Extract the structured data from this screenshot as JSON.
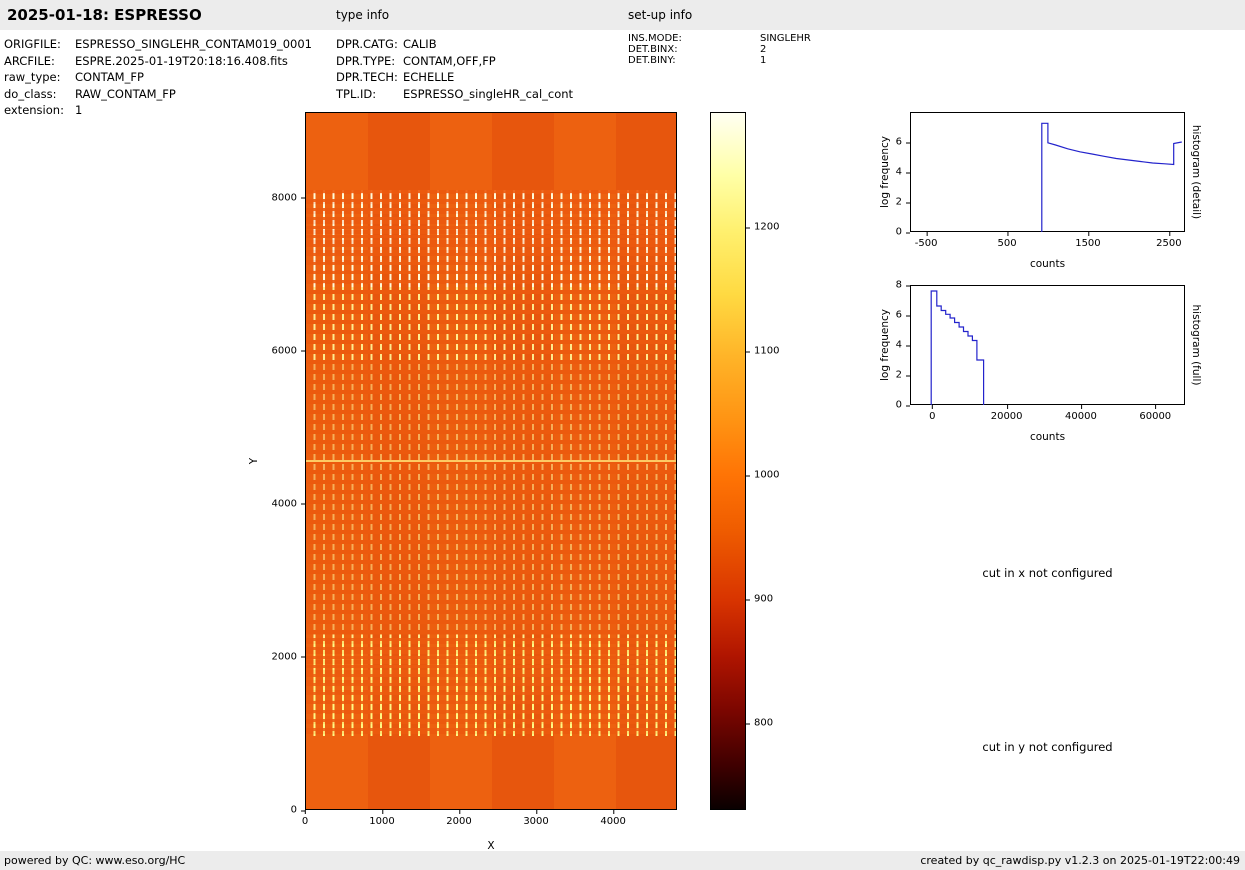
{
  "header": {
    "title": "2025-01-18: ESPRESSO",
    "type_info_label": "type info",
    "setup_info_label": "set-up info"
  },
  "metadata": {
    "file": [
      {
        "label": "ORIGFILE:",
        "value": "ESPRESSO_SINGLEHR_CONTAM019_0001"
      },
      {
        "label": "ARCFILE:",
        "value": "ESPRE.2025-01-19T20:18:16.408.fits"
      },
      {
        "label": "raw_type:",
        "value": "CONTAM_FP"
      },
      {
        "label": "do_class:",
        "value": "RAW_CONTAM_FP"
      },
      {
        "label": "extension:",
        "value": "1"
      }
    ],
    "type_info": [
      {
        "label": "DPR.CATG:",
        "value": "CALIB"
      },
      {
        "label": "DPR.TYPE:",
        "value": "CONTAM,OFF,FP"
      },
      {
        "label": "DPR.TECH:",
        "value": "ECHELLE"
      },
      {
        "label": "TPL.ID:",
        "value": "ESPRESSO_singleHR_cal_cont"
      }
    ],
    "setup_info": [
      {
        "label": "INS.MODE:",
        "value": "SINGLEHR"
      },
      {
        "label": "DET.BINX:",
        "value": "2"
      },
      {
        "label": "DET.BINY:",
        "value": "1"
      }
    ]
  },
  "chart_data": [
    {
      "id": "raw",
      "type": "heatmap",
      "xlabel": "X",
      "ylabel": "Y",
      "xlim": [
        0,
        4830
      ],
      "ylim": [
        0,
        9120
      ],
      "x_ticks": [
        0,
        1000,
        2000,
        3000,
        4000
      ],
      "y_ticks": [
        0,
        2000,
        4000,
        6000,
        8000
      ],
      "colormap": "hot",
      "description": "Raw ESPRESSO CONTAM_FP echelle frame: orange background near 1000 counts with dense columns of bright dashed Fabry-Perot emission lines between y~1000 and y~8200, brightest near the top and bottom of the order region, plus a thin bright horizontal feature near y~4600"
    },
    {
      "id": "colorbar",
      "type": "colorbar",
      "ylim": [
        730,
        1293
      ],
      "y_ticks": [
        1200,
        1100,
        1000,
        900,
        800
      ]
    },
    {
      "id": "hist-detail",
      "type": "line",
      "title": "histogram (detail)",
      "xlabel": "counts",
      "ylabel": "log frequency",
      "xlim": [
        -700,
        2700
      ],
      "ylim": [
        0,
        8
      ],
      "x_ticks": [
        -500,
        500,
        1500,
        2500
      ],
      "y_ticks": [
        0,
        2,
        4,
        6
      ],
      "points": [
        [
          930,
          0
        ],
        [
          930,
          7.25
        ],
        [
          1005,
          7.25
        ],
        [
          1005,
          5.95
        ],
        [
          1100,
          5.8
        ],
        [
          1250,
          5.55
        ],
        [
          1400,
          5.35
        ],
        [
          1550,
          5.2
        ],
        [
          1700,
          5.05
        ],
        [
          1850,
          4.9
        ],
        [
          2000,
          4.8
        ],
        [
          2150,
          4.7
        ],
        [
          2300,
          4.6
        ],
        [
          2450,
          4.55
        ],
        [
          2560,
          4.5
        ],
        [
          2560,
          5.9
        ],
        [
          2660,
          6.0
        ]
      ]
    },
    {
      "id": "hist-full",
      "type": "line",
      "title": "histogram (full)",
      "xlabel": "counts",
      "ylabel": "log frequency",
      "xlim": [
        -6000,
        68000
      ],
      "ylim": [
        0,
        8
      ],
      "x_ticks": [
        0,
        20000,
        40000,
        60000
      ],
      "y_ticks": [
        0,
        2,
        4,
        6,
        8
      ],
      "points": [
        [
          -300,
          0
        ],
        [
          -300,
          7.6
        ],
        [
          1200,
          7.6
        ],
        [
          1200,
          6.6
        ],
        [
          2400,
          6.6
        ],
        [
          2400,
          6.3
        ],
        [
          3600,
          6.3
        ],
        [
          3600,
          6.05
        ],
        [
          4800,
          6.05
        ],
        [
          4800,
          5.8
        ],
        [
          6000,
          5.8
        ],
        [
          6000,
          5.5
        ],
        [
          7200,
          5.5
        ],
        [
          7200,
          5.2
        ],
        [
          8400,
          5.2
        ],
        [
          8400,
          4.9
        ],
        [
          9600,
          4.9
        ],
        [
          9600,
          4.6
        ],
        [
          10800,
          4.6
        ],
        [
          10800,
          4.3
        ],
        [
          12000,
          4.3
        ],
        [
          12000,
          3.0
        ],
        [
          13800,
          3.0
        ],
        [
          13800,
          0
        ]
      ]
    }
  ],
  "messages": {
    "cut_x": "cut in x not configured",
    "cut_y": "cut in y not configured"
  },
  "footer": {
    "left": "powered by QC: www.eso.org/HC",
    "right": "created by qc_rawdisp.py v1.2.3 on 2025-01-19T22:00:49"
  },
  "colors": {
    "histogram_line": "#2323cc",
    "header_bg": "#ececec",
    "footer_bg": "#ececec",
    "image_base": "#ec5a0e",
    "frame": "#000000"
  }
}
